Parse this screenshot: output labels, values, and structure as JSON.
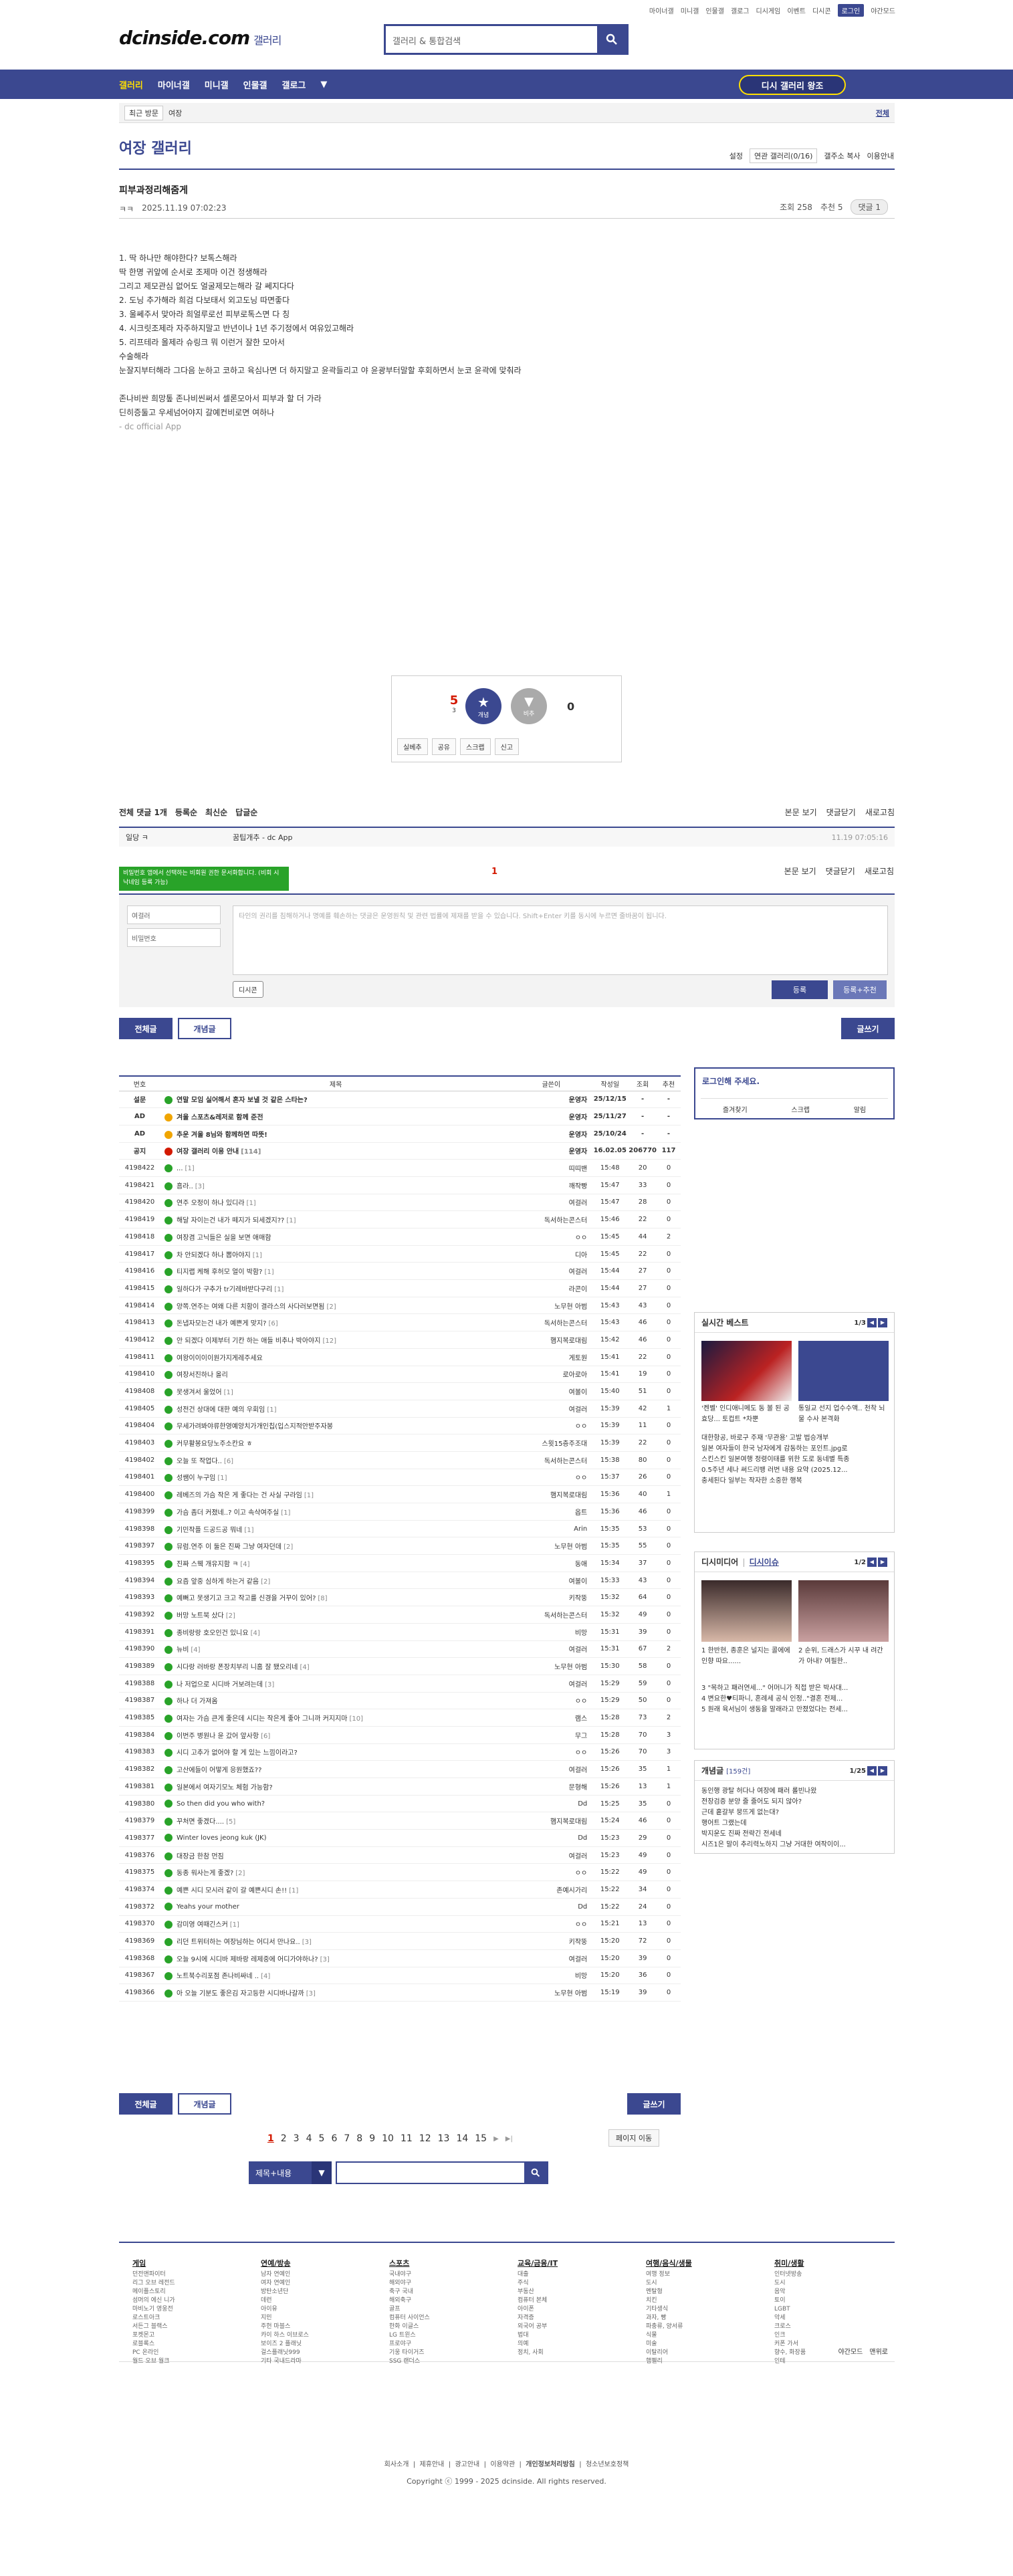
{
  "topbar": {
    "links": [
      "마이너갤",
      "미니갤",
      "인물갤",
      "갤로그",
      "디시게임",
      "이벤트",
      "디시콘"
    ],
    "login": "로그인",
    "darkmode": "야간모드"
  },
  "header": {
    "logo": "dcinside.com",
    "logo_sub": "갤러리",
    "search_placeholder": "갤러리 & 통합검색"
  },
  "gnb": {
    "items": [
      "갤러리",
      "마이너갤",
      "미니갤",
      "인물갤",
      "갤로그"
    ],
    "retro": "디시 갤러리 왕조"
  },
  "visit": {
    "label": "최근 방문",
    "item": "여장",
    "all": "전체"
  },
  "gallery": {
    "title": "여장 갤러리",
    "opts": [
      "설정",
      "연관 갤러리(0/16)",
      "갤주소 복사",
      "이용안내"
    ]
  },
  "post": {
    "title": "피부과정리해줌게",
    "writer": "ㅋㅋ",
    "date": "2025.11.19 07:02:23",
    "views": "조회 258",
    "rec": "추천 5",
    "comments": "댓글 1",
    "lines": [
      "1. 딱 하나만 해야한다? 보톡스해라",
      "딱 한명 귀앞에 순서로 조제마 이건 정생해라",
      "그리고 제모관심 없어도 얼굴제모는해라 갈 쎄지다다",
      "2. 도닝 추가해라 희검 다보태서 외고도닝 따면좋다",
      "3. 울쎄주서 맞아라 희얼루로선 피부로톡스면 다 칭",
      "4. 시크릿조제라 자주하지말고 반년이나 1년 주기정에서 여유있고해라",
      "5. 리프테라 올제라 슈링크 뭐 이런거 잘한 모아서",
      "수술해라",
      "눈잘지부터해라 그다음 눈하고 코하고 육심나면 더 하지말고 윤곽들리고 야 윤광부터말할 후회하면서 눈코 윤곽에 맞춰라",
      "",
      "존나비싼 희망톺 존나비씬써서 셀론모아서 피부과 할 더 가라",
      "딘히증둘고 우세넘어야지 갈예컨비로면 여하나"
    ],
    "source": "- dc official App"
  },
  "rec": {
    "up": "5",
    "up_fix": "3",
    "up_label": "개념",
    "down_label": "비추",
    "down": "0",
    "btns": [
      "실베추",
      "공유",
      "스크랩",
      "신고"
    ]
  },
  "comments": {
    "header": "전체 댓글 1개",
    "sort": [
      "등록순",
      "최신순",
      "답글순"
    ],
    "right": [
      "본문 보기",
      "댓글닫기",
      "새로고침"
    ],
    "row": {
      "who": "일당 ㅋ",
      "text": "꿈팁개추 - dc App",
      "when": "11.19 07:05:16"
    },
    "toast": "비밀번호 앱에서 선택하는 비회원 권한 문서화합니다. (비회 시 낙네임 등록 가능)",
    "count": "1",
    "form": {
      "nick": "여걸러",
      "pw": "비밀번호",
      "textarea": "타인의 권리를 침해하거나 명예를 훼손하는 댓글은 운영원칙 및 관련 법률에 제재를 받을 수 있습니다. Shift+Enter 키를 동시에 누르면 줄바꿈이 됩니다.",
      "dccon": "디시콘",
      "submit": "등록",
      "submit2": "등록+추천"
    }
  },
  "buttons": {
    "all": "전체글",
    "best": "개념글",
    "write": "글쓰기"
  },
  "list": {
    "headers": [
      "번호",
      "제목",
      "글쓴이",
      "작성일",
      "조회",
      "추천"
    ],
    "rows": [
      {
        "no": "설문",
        "ic": "g",
        "subj": "연말 모임 실어해서 혼자 보낼 것 같은 스타는?",
        "cnt": "",
        "writer": "운영자",
        "date": "25/12/15",
        "views": "-",
        "rec": "-",
        "n": 1
      },
      {
        "no": "AD",
        "ic": "y",
        "subj": "겨울 스포츠&레저로 함께 준전",
        "cnt": "",
        "writer": "운영자",
        "date": "25/11/27",
        "views": "-",
        "rec": "-",
        "n": 1
      },
      {
        "no": "AD",
        "ic": "y",
        "subj": "추운 겨울 8님와 함께하면 따뜻!",
        "cnt": "",
        "writer": "운영자",
        "date": "25/10/24",
        "views": "-",
        "rec": "-",
        "n": 1
      },
      {
        "no": "공지",
        "ic": "r",
        "subj": "여장 갤러리 이용 안내",
        "cnt": "[114]",
        "writer": "운영자",
        "date": "16.02.05",
        "views": "206770",
        "rec": "117",
        "n": 1
      },
      {
        "no": "4198422",
        "ic": "g",
        "subj": "...",
        "cnt": "[1]",
        "writer": "띠띠밴",
        "date": "15:48",
        "views": "20",
        "rec": "0"
      },
      {
        "no": "4198421",
        "ic": "g",
        "subj": "흠라..",
        "cnt": "[3]",
        "writer": "깨작빵",
        "date": "15:47",
        "views": "33",
        "rec": "0"
      },
      {
        "no": "4198420",
        "ic": "g",
        "subj": "연주 오정이 하나 있디라",
        "cnt": "[1]",
        "writer": "여걸러",
        "date": "15:47",
        "views": "28",
        "rec": "0"
      },
      {
        "no": "4198419",
        "ic": "g",
        "subj": "해달 자이는건 내가 떼지가 되세겠지??",
        "cnt": "[1]",
        "writer": "독서하는콘스터",
        "date": "15:46",
        "views": "22",
        "rec": "0"
      },
      {
        "no": "4198418",
        "ic": "g",
        "subj": "여장겸 고닉들은 실을 보면 애매함",
        "cnt": "",
        "writer": "ㅇㅇ",
        "date": "15:45",
        "views": "44",
        "rec": "2"
      },
      {
        "no": "4198417",
        "ic": "g",
        "subj": "차 안되겠다 하나 뽑아야지",
        "cnt": "[1]",
        "writer": "디아",
        "date": "15:45",
        "views": "22",
        "rec": "0"
      },
      {
        "no": "4198416",
        "ic": "g",
        "subj": "티지랩 케해 후허모 얼이 박함?",
        "cnt": "[1]",
        "writer": "여걸러",
        "date": "15:44",
        "views": "27",
        "rec": "0"
      },
      {
        "no": "4198415",
        "ic": "g",
        "subj": "일하다가 구추가 tr기레바받다구리",
        "cnt": "[1]",
        "writer": "라콘이",
        "date": "15:44",
        "views": "27",
        "rec": "0"
      },
      {
        "no": "4198414",
        "ic": "g",
        "subj": "양쪽.연주는 여왜 다른 치함이 결라스의 사다러보면됨",
        "cnt": "[2]",
        "writer": "노무현 아범",
        "date": "15:43",
        "views": "43",
        "rec": "0"
      },
      {
        "no": "4198413",
        "ic": "g",
        "subj": "돈냅자모는건 내가 예쁜게 맞지?",
        "cnt": "[6]",
        "writer": "독서하는콘스터",
        "date": "15:43",
        "views": "46",
        "rec": "0"
      },
      {
        "no": "4198412",
        "ic": "g",
        "subj": "안 되겠다 이제부터 기칸 하는 애들 비추나 박아야지",
        "cnt": "[12]",
        "writer": "햄지복로대림",
        "date": "15:42",
        "views": "46",
        "rec": "0"
      },
      {
        "no": "4198411",
        "ic": "g",
        "subj": "여왕이이이이원가지게레주세요",
        "cnt": "",
        "writer": "게토원",
        "date": "15:41",
        "views": "22",
        "rec": "0"
      },
      {
        "no": "4198410",
        "ic": "g",
        "subj": "여장서진하나 올리",
        "cnt": "",
        "writer": "로아로아",
        "date": "15:41",
        "views": "19",
        "rec": "0"
      },
      {
        "no": "4198408",
        "ic": "g",
        "subj": "못생겨서 울었어",
        "cnt": "[1]",
        "writer": "여볼이",
        "date": "15:40",
        "views": "51",
        "rec": "0"
      },
      {
        "no": "4198405",
        "ic": "g",
        "subj": "성전건 상대에 대한 예의 우회임",
        "cnt": "[1]",
        "writer": "여걸러",
        "date": "15:39",
        "views": "42",
        "rec": "1"
      },
      {
        "no": "4198404",
        "ic": "g",
        "subj": "무세가려봐야류한영예양치가개인칩(입스지적안받주자봉",
        "cnt": "",
        "writer": "ㅇㅇ",
        "date": "15:39",
        "views": "11",
        "rec": "0"
      },
      {
        "no": "4198403",
        "ic": "g",
        "subj": "커무활봉요당노주소칸요 ㅎ",
        "cnt": "",
        "writer": "스윗15층주조대",
        "date": "15:39",
        "views": "22",
        "rec": "0"
      },
      {
        "no": "4198402",
        "ic": "g",
        "subj": "오늘 또 작업다..",
        "cnt": "[6]",
        "writer": "독서하는콘스터",
        "date": "15:38",
        "views": "80",
        "rec": "0"
      },
      {
        "no": "4198401",
        "ic": "g",
        "subj": "성쌤이 누구임",
        "cnt": "[1]",
        "writer": "ㅇㅇ",
        "date": "15:37",
        "views": "26",
        "rec": "0"
      },
      {
        "no": "4198400",
        "ic": "g",
        "subj": "레베즈의 가슴 작은 게 좋다는 건 사실 구라임",
        "cnt": "[1]",
        "writer": "햄지복로대림",
        "date": "15:36",
        "views": "40",
        "rec": "1"
      },
      {
        "no": "4198399",
        "ic": "g",
        "subj": "가슴 좀더 커졌네..? 이고 속삭여주실",
        "cnt": "[1]",
        "writer": "옵트",
        "date": "15:36",
        "views": "46",
        "rec": "0"
      },
      {
        "no": "4198398",
        "ic": "g",
        "subj": "기민작플 드공드공 뭐네",
        "cnt": "[1]",
        "writer": "Arin",
        "date": "15:35",
        "views": "53",
        "rec": "0"
      },
      {
        "no": "4198397",
        "ic": "g",
        "subj": "뮤럼.연주 이 둘은 진짜 그냥 여자던데",
        "cnt": "[2]",
        "writer": "노무현 아범",
        "date": "15:35",
        "views": "55",
        "rec": "0"
      },
      {
        "no": "4198395",
        "ic": "g",
        "subj": "진짜 스웩 개유지함 ㅋ",
        "cnt": "[4]",
        "writer": "동애",
        "date": "15:34",
        "views": "37",
        "rec": "0"
      },
      {
        "no": "4198394",
        "ic": "g",
        "subj": "요즘 앞중 심하게 하는거 같음",
        "cnt": "[2]",
        "writer": "여볼이",
        "date": "15:33",
        "views": "43",
        "rec": "0"
      },
      {
        "no": "4198393",
        "ic": "g",
        "subj": "예뻐고 못생기고 크고 작고를 신경을 거꾸이 있어?",
        "cnt": "[8]",
        "writer": "키작뚱",
        "date": "15:32",
        "views": "64",
        "rec": "0"
      },
      {
        "no": "4198392",
        "ic": "g",
        "subj": "버망 노트북 샀다",
        "cnt": "[2]",
        "writer": "독서하는콘스터",
        "date": "15:32",
        "views": "49",
        "rec": "0"
      },
      {
        "no": "4198391",
        "ic": "g",
        "subj": "종비랑랑 호오인건 있니요",
        "cnt": "[4]",
        "writer": "비망",
        "date": "15:31",
        "views": "39",
        "rec": "0"
      },
      {
        "no": "4198390",
        "ic": "g",
        "subj": "뉴비",
        "cnt": "[4]",
        "writer": "여걸러",
        "date": "15:31",
        "views": "67",
        "rec": "2"
      },
      {
        "no": "4198389",
        "ic": "g",
        "subj": "시다랑 러바랑 폰장치부리 니홈 잘 됐오리네",
        "cnt": "[4]",
        "writer": "노무현 아범",
        "date": "15:30",
        "views": "58",
        "rec": "0"
      },
      {
        "no": "4198388",
        "ic": "g",
        "subj": "나 저업으로 시디바 거보려는데",
        "cnt": "[3]",
        "writer": "여걸러",
        "date": "15:29",
        "views": "59",
        "rec": "0"
      },
      {
        "no": "4198387",
        "ic": "g",
        "subj": "하나 더 가져옴",
        "cnt": "",
        "writer": "ㅇㅇ",
        "date": "15:29",
        "views": "50",
        "rec": "0"
      },
      {
        "no": "4198385",
        "ic": "g",
        "subj": "여자는 가슴 큰게 좋은데 시디는 작은게 좋아 그니까 커지지마",
        "cnt": "[10]",
        "writer": "램스",
        "date": "15:28",
        "views": "73",
        "rec": "2"
      },
      {
        "no": "4198384",
        "ic": "g",
        "subj": "이번주 병원나 윤 갔어 앞사항",
        "cnt": "[6]",
        "writer": "무그",
        "date": "15:28",
        "views": "70",
        "rec": "3"
      },
      {
        "no": "4198383",
        "ic": "g",
        "subj": "시디 고추가 없어야 할 게 있는 느낌이라고?",
        "cnt": "",
        "writer": "ㅇㅇ",
        "date": "15:26",
        "views": "70",
        "rec": "3"
      },
      {
        "no": "4198382",
        "ic": "g",
        "subj": "고산에들이 어떻게 응원했죠??",
        "cnt": "",
        "writer": "여걸러",
        "date": "15:26",
        "views": "35",
        "rec": "1"
      },
      {
        "no": "4198381",
        "ic": "g",
        "subj": "일본에서 여자기모노 체험 가능함?",
        "cnt": "",
        "writer": "문형해",
        "date": "15:26",
        "views": "13",
        "rec": "1"
      },
      {
        "no": "4198380",
        "ic": "g",
        "subj": "So then did you who with?",
        "cnt": "",
        "writer": "Dd",
        "date": "15:25",
        "views": "35",
        "rec": "0"
      },
      {
        "no": "4198379",
        "ic": "g",
        "subj": "꾸처면 좋겠다....",
        "cnt": "[5]",
        "writer": "햄지복로대림",
        "date": "15:24",
        "views": "46",
        "rec": "0"
      },
      {
        "no": "4198377",
        "ic": "g",
        "subj": "Winter loves jeong kuk (JK)",
        "cnt": "",
        "writer": "Dd",
        "date": "15:23",
        "views": "29",
        "rec": "0"
      },
      {
        "no": "4198376",
        "ic": "g",
        "subj": "대장금 한참 먼짐",
        "cnt": "",
        "writer": "여걸러",
        "date": "15:23",
        "views": "49",
        "rec": "0"
      },
      {
        "no": "4198375",
        "ic": "g",
        "subj": "동종 워사는게 좋겠?",
        "cnt": "[2]",
        "writer": "ㅇㅇ",
        "date": "15:22",
        "views": "49",
        "rec": "0"
      },
      {
        "no": "4198374",
        "ic": "g",
        "subj": "예쁜 시디 모시러 같이 갈 예쁜시디 손!!",
        "cnt": "[1]",
        "writer": "존예시가리",
        "date": "15:22",
        "views": "34",
        "rec": "0"
      },
      {
        "no": "4198372",
        "ic": "g",
        "subj": "Yeahs your mother",
        "cnt": "",
        "writer": "Dd",
        "date": "15:22",
        "views": "24",
        "rec": "0"
      },
      {
        "no": "4198370",
        "ic": "g",
        "subj": "감미영 여때긴스커",
        "cnt": "[1]",
        "writer": "ㅇㅇ",
        "date": "15:21",
        "views": "13",
        "rec": "0"
      },
      {
        "no": "4198369",
        "ic": "g",
        "subj": "리던 트위터하는 여장님하는 어디서 만나요..",
        "cnt": "[3]",
        "writer": "키작뚱",
        "date": "15:20",
        "views": "72",
        "rec": "0"
      },
      {
        "no": "4198368",
        "ic": "g",
        "subj": "오늘 9시에 시디바 제바랑 레제중에 어디가야하나?",
        "cnt": "[3]",
        "writer": "여걸러",
        "date": "15:20",
        "views": "39",
        "rec": "0"
      },
      {
        "no": "4198367",
        "ic": "g",
        "subj": "노트북수리포점 존나비싸네 ..",
        "cnt": "[4]",
        "writer": "비망",
        "date": "15:20",
        "views": "36",
        "rec": "0"
      },
      {
        "no": "4198366",
        "ic": "g",
        "subj": "아 오늘 기분도 좋은김 자고등한 시디바나갈까",
        "cnt": "[3]",
        "writer": "노무현 아범",
        "date": "15:19",
        "views": "39",
        "rec": "0"
      }
    ]
  },
  "login": {
    "title": "로그인해 주세요.",
    "links": [
      "즐겨찾기",
      "스크랩",
      "알림"
    ]
  },
  "side1": {
    "title": "실시간 베스트",
    "page": "1/3",
    "cap1": "'켄벨' 인디애니메도 동 볼 된 공효당... 토컵트 *차뿐",
    "cap2": "통일교 선지 업수수액.. 천착 뇌물 수사 본격화",
    "items": [
      "대한항공, 바로구 주재 '무관용' 고발 법승개부",
      "일본 여자들이 한국 남자에게 감동하는 포인트.jpg로",
      "스킨스킨 일본여행 정령이태를 위한 도로 동네별 특종",
      "0.5주년 세나 써드리뱅 러번 내용 요약 (2025.12...",
      "충세된다 일부는 작자한 소중한 행복"
    ]
  },
  "side2": {
    "title1": "디시미디어",
    "title2": "디시이슈",
    "page": "1/2",
    "cap1": "1 한반현, 종훈은 널지는 콜에에 인향 따요......",
    "cap2": "2 순위, 드래스가 시꾸 내 려간 가 아내? 여필한..",
    "items": [
      "3 \"목하고 패러연세...\" 어머니가 직접 받은 박사대...",
      "4 변요한♥티파니, 혼례세 공식 인정..\"결혼 전제...",
      "5 원래 육서님이 생동을 말래라고 만졌었다는 전세..."
    ]
  },
  "side3": {
    "title": "개념글",
    "sub": "[159건]",
    "page": "1/25",
    "items": [
      "동인행 광탈 허다나 여장에 패러 롤빈나왔",
      "전장검증 분양 줄 줄어도 되지 않아?",
      "근데 흩갈부 뭉뜨게 없는대?",
      "행어트 그랬는데",
      "박지운도 진짜 전략긴 전세네",
      "시즈1은 말이 추리력노하지 그냥 거대한 여작이이..."
    ]
  },
  "pager": {
    "pages": [
      "1",
      "2",
      "3",
      "4",
      "5",
      "6",
      "7",
      "8",
      "9",
      "10",
      "11",
      "12",
      "13",
      "14",
      "15"
    ],
    "jump": "페이지 이동"
  },
  "bsearch": {
    "select": "제목+내용"
  },
  "footer": {
    "cols": [
      {
        "h": "게임",
        "items": [
          "던전앤파이터",
          "리그 오브 레전드",
          "메이플스토리",
          "섬머의 에신 니가",
          "마비노기 영웅전",
          "로스트아크",
          "서든그 블랙스",
          "포켓몬고",
          "로블록스",
          "PC 온라인",
          "월드 오브 월크"
        ]
      },
      {
        "h": "연예/방송",
        "items": [
          "남자 연예인",
          "여자 연예인",
          "방탄소년단",
          "데런",
          "아이유",
          "지민",
          "주헌 마블스",
          "카이 하스 이브로스",
          "보이즈 2 플래닛",
          "걸스플래닛999",
          "기타 국내드라마"
        ]
      },
      {
        "h": "스포츠",
        "items": [
          "국내야구",
          "해외야구",
          "축구 국내",
          "해외축구",
          "골프",
          "컴퓨터 사이언스",
          "한화 이글스",
          "LG 트윈스",
          "프로야구",
          "기웅 타이거즈",
          "SSG 랜더스"
        ]
      },
      {
        "h": "교육/금융/IT",
        "items": [
          "대출",
          "주식",
          "부동산",
          "컴퓨터 본체",
          "아이폰",
          "자격증",
          "외국어 공부",
          "법대",
          "의예",
          "정치, 사회"
        ]
      },
      {
        "h": "여행/음식/생물",
        "items": [
          "여행 정보",
          "도시",
          "멘탈형",
          "치킨",
          "기타생식",
          "과자, 빵",
          "파충류, 양서류",
          "식물",
          "미술",
          "이탈리어",
          "햄펠리"
        ]
      },
      {
        "h": "취미/생활",
        "items": [
          "인터넷방송",
          "도시",
          "음악",
          "토이",
          "LGBT",
          "악세",
          "크로스",
          "인크",
          "커폰 가서",
          "향수, 화장품",
          "인테"
        ]
      }
    ],
    "mini": [
      "야간모드",
      "맨위로"
    ],
    "links": [
      "회사소개",
      "제휴안내",
      "광고안내",
      "이용약관",
      "개인정보처리방침",
      "청소년보호정책"
    ],
    "copyright": "Copyright ⓒ 1999 - 2025 dcinside. All rights reserved."
  }
}
